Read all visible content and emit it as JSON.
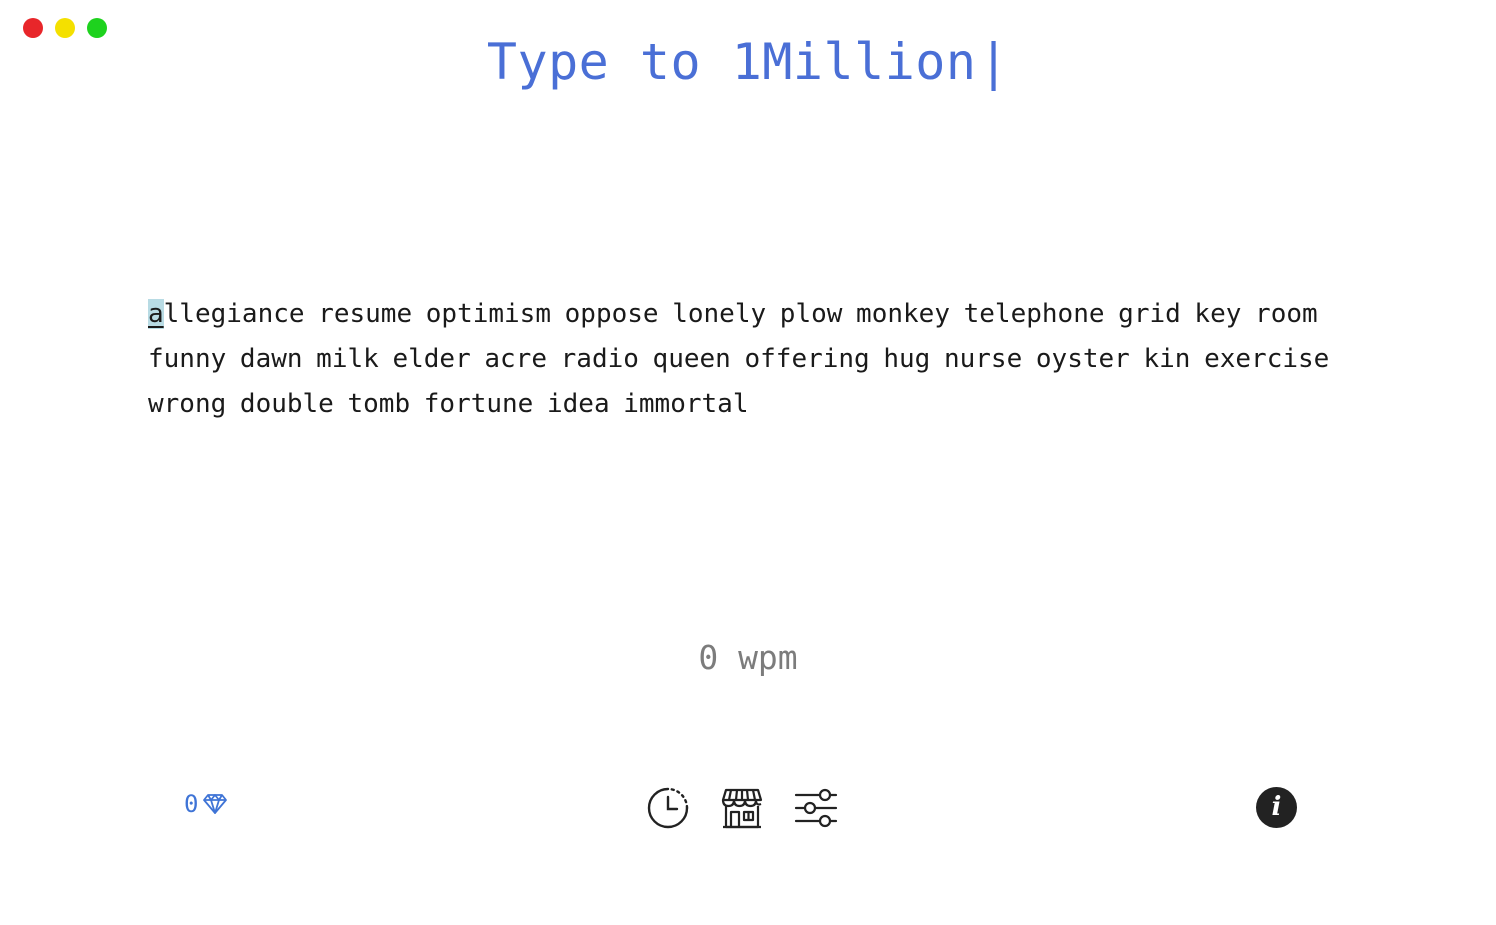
{
  "window": {
    "controls": [
      "close",
      "minimize",
      "maximize"
    ]
  },
  "header": {
    "title": "Type to 1Million",
    "caret": "|"
  },
  "typing": {
    "current_char": "a",
    "rest_text": "llegiance resume optimism oppose lonely plow monkey telephone grid key room funny dawn milk elder acre radio queen offering hug nurse oyster kin exercise wrong double tomb fortune idea immortal"
  },
  "stats": {
    "wpm": "0 wpm"
  },
  "footer": {
    "gems_count": "0",
    "icons": {
      "gem": "diamond-icon",
      "history": "clock-history-icon",
      "shop": "store-icon",
      "settings": "sliders-icon",
      "info": "info-icon"
    },
    "info_label": "i"
  },
  "colors": {
    "accent": "#4a6fd6",
    "gem": "#3f74d6",
    "highlight": "#b8dbe4",
    "text": "#1a1a1a",
    "muted": "#7c7c7c"
  }
}
